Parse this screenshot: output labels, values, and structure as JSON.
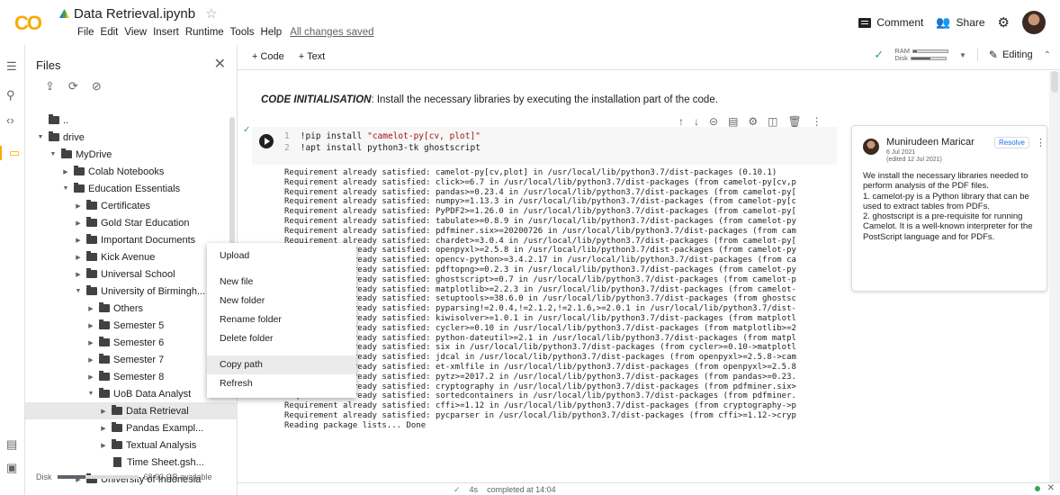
{
  "header": {
    "logo": "CO",
    "notebook_title": "Data Retrieval.ipynb",
    "menu": [
      "File",
      "Edit",
      "View",
      "Insert",
      "Runtime",
      "Tools",
      "Help"
    ],
    "save_status": "All changes saved",
    "comment_label": "Comment",
    "share_label": "Share"
  },
  "files": {
    "title": "Files",
    "tree": [
      {
        "label": "..",
        "depth": 0,
        "arrow": "",
        "kind": "folder"
      },
      {
        "label": "drive",
        "depth": 0,
        "arrow": "down",
        "kind": "folder"
      },
      {
        "label": "MyDrive",
        "depth": 1,
        "arrow": "down",
        "kind": "folder"
      },
      {
        "label": "Colab Notebooks",
        "depth": 2,
        "arrow": "right",
        "kind": "folder"
      },
      {
        "label": "Education Essentials",
        "depth": 2,
        "arrow": "down",
        "kind": "folder"
      },
      {
        "label": "Certificates",
        "depth": 3,
        "arrow": "right",
        "kind": "folder"
      },
      {
        "label": "Gold Star Education",
        "depth": 3,
        "arrow": "right",
        "kind": "folder"
      },
      {
        "label": "Important Documents",
        "depth": 3,
        "arrow": "right",
        "kind": "folder"
      },
      {
        "label": "Kick Avenue",
        "depth": 3,
        "arrow": "right",
        "kind": "folder"
      },
      {
        "label": "Universal School",
        "depth": 3,
        "arrow": "right",
        "kind": "folder"
      },
      {
        "label": "University of Birmingh...",
        "depth": 3,
        "arrow": "down",
        "kind": "folder"
      },
      {
        "label": "Others",
        "depth": 4,
        "arrow": "right",
        "kind": "folder"
      },
      {
        "label": "Semester 5",
        "depth": 4,
        "arrow": "right",
        "kind": "folder"
      },
      {
        "label": "Semester 6",
        "depth": 4,
        "arrow": "right",
        "kind": "folder"
      },
      {
        "label": "Semester 7",
        "depth": 4,
        "arrow": "right",
        "kind": "folder"
      },
      {
        "label": "Semester 8",
        "depth": 4,
        "arrow": "right",
        "kind": "folder"
      },
      {
        "label": "UoB Data Analyst",
        "depth": 4,
        "arrow": "down",
        "kind": "folder"
      },
      {
        "label": "Data Retrieval",
        "depth": 5,
        "arrow": "right",
        "kind": "folder",
        "selected": true
      },
      {
        "label": "Pandas Exampl...",
        "depth": 5,
        "arrow": "right",
        "kind": "folder"
      },
      {
        "label": "Textual Analysis",
        "depth": 5,
        "arrow": "right",
        "kind": "folder"
      },
      {
        "label": "Time Sheet.gsh...",
        "depth": 5,
        "arrow": "",
        "kind": "file"
      },
      {
        "label": "University of Indonesia",
        "depth": 3,
        "arrow": "right",
        "kind": "folder"
      }
    ],
    "disk_label": "Disk",
    "disk_available": "68.93 GB available",
    "disk_used_fraction": 0.35
  },
  "context_menu": {
    "items": [
      {
        "label": "Upload",
        "gap_after": true
      },
      {
        "label": "New file"
      },
      {
        "label": "New folder"
      },
      {
        "label": "Rename folder"
      },
      {
        "label": "Delete folder",
        "gap_after": true
      },
      {
        "label": "Copy path",
        "highlighted": true
      },
      {
        "label": "Refresh"
      }
    ]
  },
  "toolbar": {
    "add_code": "+ Code",
    "add_text": "+ Text",
    "ram_label": "RAM",
    "disk_label": "Disk",
    "editing_label": "Editing"
  },
  "notebook": {
    "intro_bold": "CODE INITIALISATION",
    "intro_rest": ": Install the necessary libraries by executing the installation part of the code.",
    "code_lines": [
      {
        "n": "1",
        "pre": "!pip install ",
        "str": "\"camelot-py[cv, plot]\""
      },
      {
        "n": "2",
        "pre": "!apt install python3-tk ghostscript",
        "str": ""
      }
    ],
    "output_lines": [
      "Requirement already satisfied: camelot-py[cv,plot] in /usr/local/lib/python3.7/dist-packages (0.10.1)",
      "Requirement already satisfied: click>=6.7 in /usr/local/lib/python3.7/dist-packages (from camelot-py[cv,p",
      "Requirement already satisfied: pandas>=0.23.4 in /usr/local/lib/python3.7/dist-packages (from camelot-py[",
      "Requirement already satisfied: numpy>=1.13.3 in /usr/local/lib/python3.7/dist-packages (from camelot-py[c",
      "Requirement already satisfied: PyPDF2>=1.26.0 in /usr/local/lib/python3.7/dist-packages (from camelot-py[",
      "Requirement already satisfied: tabulate>=0.8.9 in /usr/local/lib/python3.7/dist-packages (from camelot-py",
      "Requirement already satisfied: pdfminer.six>=20200726 in /usr/local/lib/python3.7/dist-packages (from cam",
      "Requirement already satisfied: chardet>=3.0.4 in /usr/local/lib/python3.7/dist-packages (from camelot-py[",
      "Requirement already satisfied: openpyxl>=2.5.8 in /usr/local/lib/python3.7/dist-packages (from camelot-py",
      "Requirement already satisfied: opencv-python>=3.4.2.17 in /usr/local/lib/python3.7/dist-packages (from ca",
      "Requirement already satisfied: pdftopng>=0.2.3 in /usr/local/lib/python3.7/dist-packages (from camelot-py",
      "Requirement already satisfied: ghostscript>=0.7 in /usr/local/lib/python3.7/dist-packages (from camelot-p",
      "Requirement already satisfied: matplotlib>=2.2.3 in /usr/local/lib/python3.7/dist-packages (from camelot-",
      "Requirement already satisfied: setuptools>=38.6.0 in /usr/local/lib/python3.7/dist-packages (from ghostsc",
      "Requirement already satisfied: pyparsing!=2.0.4,!=2.1.2,!=2.1.6,>=2.0.1 in /usr/local/lib/python3.7/dist-",
      "Requirement already satisfied: kiwisolver>=1.0.1 in /usr/local/lib/python3.7/dist-packages (from matplotl",
      "Requirement already satisfied: cycler>=0.10 in /usr/local/lib/python3.7/dist-packages (from matplotlib>=2",
      "Requirement already satisfied: python-dateutil>=2.1 in /usr/local/lib/python3.7/dist-packages (from matpl",
      "Requirement already satisfied: six in /usr/local/lib/python3.7/dist-packages (from cycler>=0.10->matplotl",
      "Requirement already satisfied: jdcal in /usr/local/lib/python3.7/dist-packages (from openpyxl>=2.5.8->cam",
      "Requirement already satisfied: et-xmlfile in /usr/local/lib/python3.7/dist-packages (from openpyxl>=2.5.8",
      "Requirement already satisfied: pytz>=2017.2 in /usr/local/lib/python3.7/dist-packages (from pandas>=0.23.",
      "Requirement already satisfied: cryptography in /usr/local/lib/python3.7/dist-packages (from pdfminer.six>",
      "Requirement already satisfied: sortedcontainers in /usr/local/lib/python3.7/dist-packages (from pdfminer.",
      "Requirement already satisfied: cffi>=1.12 in /usr/local/lib/python3.7/dist-packages (from cryptography->p",
      "Requirement already satisfied: pycparser in /usr/local/lib/python3.7/dist-packages (from cffi>=1.12->cryp",
      "Reading package lists... Done"
    ]
  },
  "comment": {
    "author": "Munirudeen Maricar",
    "date": "6 Jul 2021",
    "edited": "(edited 12 Jul 2021)",
    "resolve_label": "Resolve",
    "body": [
      "We install the necessary libraries needed to perform analysis of the PDF files.",
      "1. camelot-py is a Python library that can be used to extract tables from PDFs.",
      "2. ghostscript is a pre-requisite for running Camelot. It is a well-known interpreter for the PostScript language and for PDFs."
    ]
  },
  "status": {
    "duration": "4s",
    "completed": "completed at 14:04"
  },
  "colors": {
    "accent": "#f9ab00",
    "success": "#34a853",
    "link": "#1a73e8"
  }
}
